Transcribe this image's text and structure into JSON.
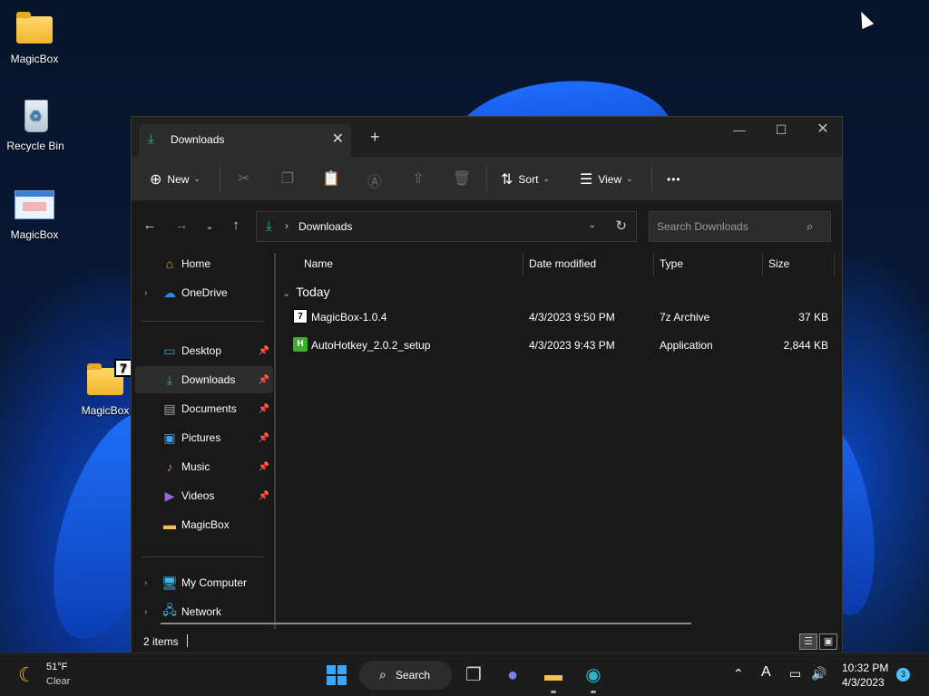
{
  "desktop": {
    "icons": [
      {
        "label": "MagicBox",
        "kind": "folder"
      },
      {
        "label": "Recycle Bin",
        "kind": "recycle-bin"
      },
      {
        "label": "MagicBox",
        "kind": "app"
      },
      {
        "label": "MagicBox",
        "kind": "7z-folder",
        "badge": "7"
      }
    ]
  },
  "window": {
    "tab": {
      "label": "Downloads",
      "close": "✕"
    },
    "new_tab": "+",
    "controls": {
      "minimize": "—",
      "maximize": "☐",
      "close": "✕"
    },
    "toolbar": {
      "new_label": "New",
      "sort_label": "Sort",
      "view_label": "View",
      "more": "•••"
    },
    "address": {
      "path": "Downloads",
      "search_placeholder": "Search Downloads"
    },
    "sidebar": {
      "items": [
        {
          "label": "Home",
          "icon": "home-icon"
        },
        {
          "label": "OneDrive",
          "icon": "cloud-icon"
        },
        {
          "label": "Desktop",
          "icon": "desktop-icon"
        },
        {
          "label": "Downloads",
          "icon": "download-icon"
        },
        {
          "label": "Documents",
          "icon": "document-icon"
        },
        {
          "label": "Pictures",
          "icon": "picture-icon"
        },
        {
          "label": "Music",
          "icon": "music-icon"
        },
        {
          "label": "Videos",
          "icon": "video-icon"
        },
        {
          "label": "MagicBox",
          "icon": "folder-icon"
        },
        {
          "label": "My Computer",
          "icon": "computer-icon"
        },
        {
          "label": "Network",
          "icon": "network-icon"
        }
      ]
    },
    "columns": {
      "name": "Name",
      "date": "Date modified",
      "type": "Type",
      "size": "Size"
    },
    "group": "Today",
    "files": [
      {
        "name": "MagicBox-1.0.4",
        "date": "4/3/2023 9:50 PM",
        "type": "7z Archive",
        "size": "37 KB",
        "icon": "7z-icon",
        "glyph": "7"
      },
      {
        "name": "AutoHotkey_2.0.2_setup",
        "date": "4/3/2023 9:43 PM",
        "type": "Application",
        "size": "2,844 KB",
        "icon": "autohotkey-icon",
        "glyph": "H"
      }
    ],
    "status": "2 items"
  },
  "taskbar": {
    "weather": {
      "temp": "51°F",
      "condition": "Clear"
    },
    "search_label": "Search",
    "clock": {
      "time": "10:32 PM",
      "date": "4/3/2023"
    },
    "notifications": "3",
    "tray_lang": "A"
  },
  "colors": {
    "accent_green": "#2fb86a",
    "start_blue": "#38a7ff",
    "window_bg": "#191919",
    "toolbar_bg": "#2c2c2c"
  }
}
